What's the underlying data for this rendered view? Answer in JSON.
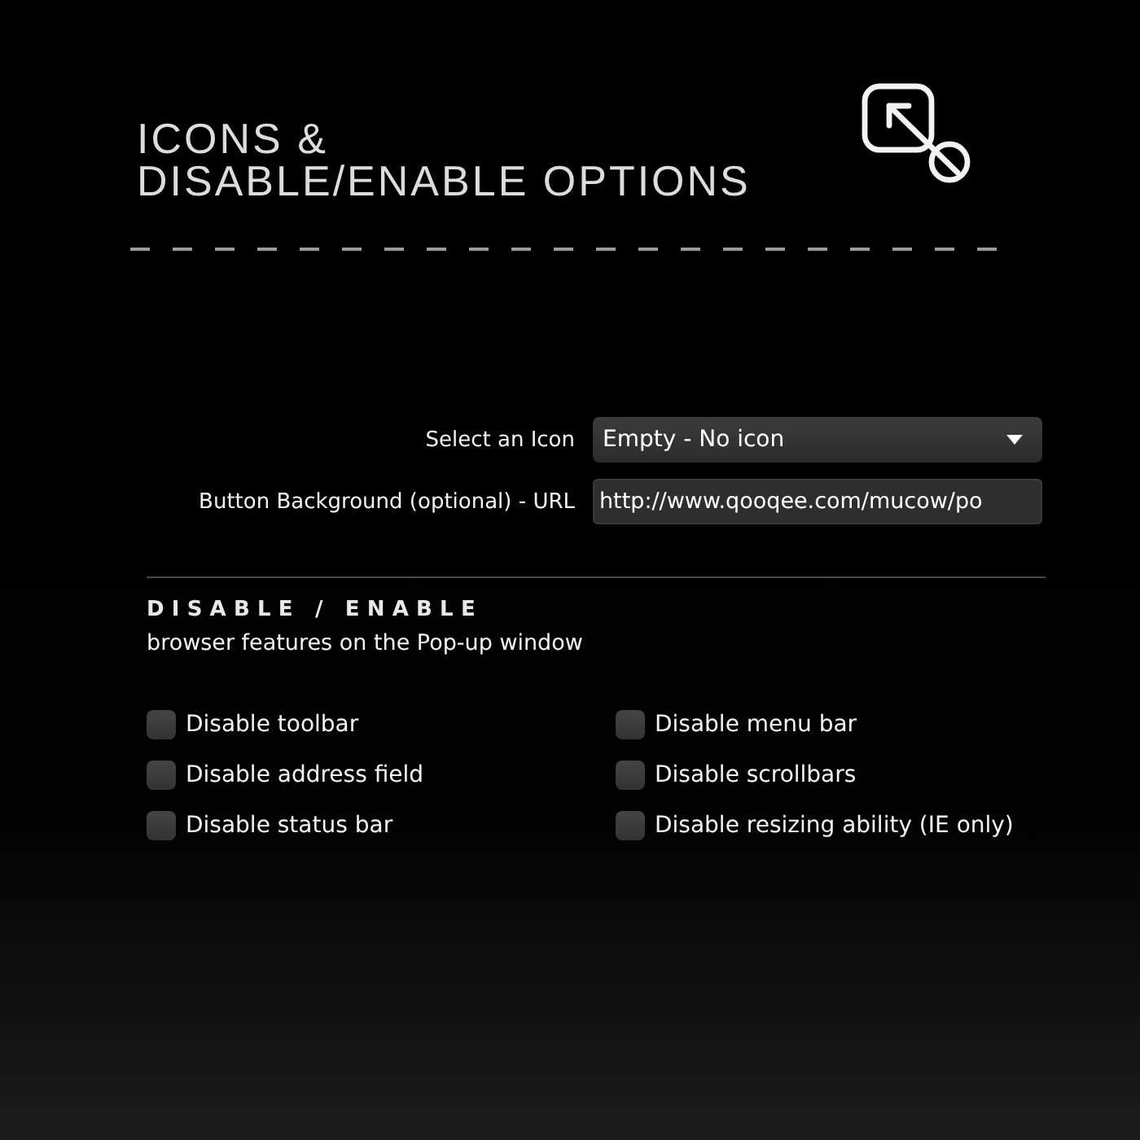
{
  "header": {
    "title": [
      "ICONS &",
      "DISABLE/ENABLE OPTIONS"
    ]
  },
  "form": {
    "fields": [
      {
        "kind": "select",
        "label": "Select an Icon",
        "value": "Empty - No icon"
      },
      {
        "kind": "text",
        "label": "Button Background (optional) - URL",
        "value": "http://www.qooqee.com/mucow/po"
      }
    ]
  },
  "features": {
    "heading": "DISABLE / ENABLE",
    "description": "browser features on the Pop-up window",
    "options": [
      {
        "label": "Disable toolbar",
        "checked": false
      },
      {
        "label": "Disable menu bar",
        "checked": false
      },
      {
        "label": "Disable address field",
        "checked": false
      },
      {
        "label": "Disable scrollbars",
        "checked": false
      },
      {
        "label": "Disable status bar",
        "checked": false
      },
      {
        "label": "Disable resizing ability (IE only)",
        "checked": false
      }
    ]
  }
}
